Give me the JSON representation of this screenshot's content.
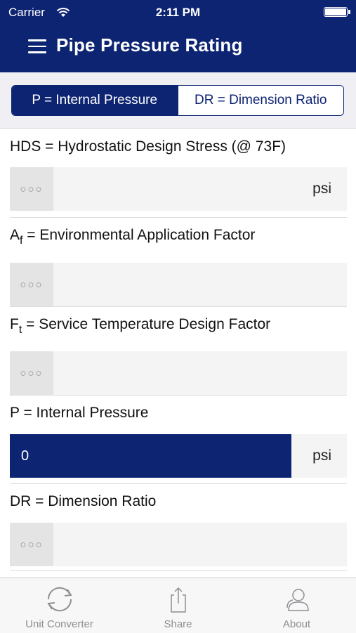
{
  "status_bar": {
    "carrier": "Carrier",
    "time": "2:11 PM"
  },
  "nav": {
    "title": "Pipe Pressure Rating"
  },
  "segmented": {
    "option1": "P = Internal Pressure",
    "option2": "DR = Dimension Ratio",
    "selected": "option1"
  },
  "fields": {
    "hds": {
      "label": "HDS = Hydrostatic Design Stress (@ 73F)",
      "unit": "psi"
    },
    "af": {
      "label_main": "A",
      "label_sub": "f",
      "label_rest": " = Environmental Application Factor"
    },
    "ft": {
      "label_main": "F",
      "label_sub": "t",
      "label_rest": " = Service Temperature Design Factor"
    },
    "p": {
      "label": "P = Internal Pressure",
      "value": "0",
      "unit": "psi"
    },
    "dr": {
      "label": "DR = Dimension Ratio"
    },
    "picker_glyph": "○○○"
  },
  "tabbar": {
    "tab1": "Unit Converter",
    "tab2": "Share",
    "tab3": "About"
  },
  "colors": {
    "primary": "#0d2472",
    "field_bg": "#f4f4f4",
    "tab_gray": "#8e8e93"
  }
}
